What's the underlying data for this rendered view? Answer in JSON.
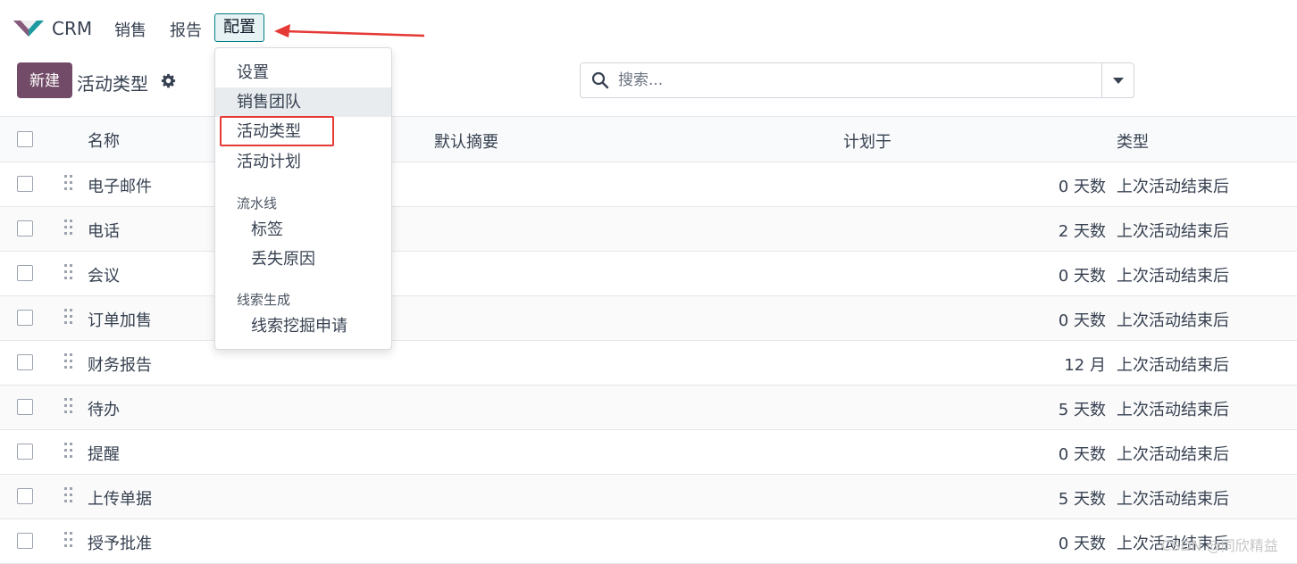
{
  "navbar": {
    "app_name": "CRM",
    "menus": [
      "销售",
      "报告",
      "配置"
    ],
    "active_menu": "配置"
  },
  "control_panel": {
    "new_button": "新建",
    "title": "活动类型",
    "search_placeholder": "搜索..."
  },
  "table": {
    "headers": {
      "name": "名称",
      "summary": "默认摘要",
      "plan": "计划于",
      "type": "类型"
    },
    "rows": [
      {
        "name": "电子邮件",
        "delay": "0 天数",
        "after": "上次活动结束后"
      },
      {
        "name": "电话",
        "delay": "2 天数",
        "after": "上次活动结束后"
      },
      {
        "name": "会议",
        "delay": "0 天数",
        "after": "上次活动结束后"
      },
      {
        "name": "订单加售",
        "delay": "0 天数",
        "after": "上次活动结束后"
      },
      {
        "name": "财务报告",
        "delay": "12 月",
        "after": "上次活动结束后"
      },
      {
        "name": "待办",
        "delay": "5 天数",
        "after": "上次活动结束后"
      },
      {
        "name": "提醒",
        "delay": "0 天数",
        "after": "上次活动结束后"
      },
      {
        "name": "上传单据",
        "delay": "5 天数",
        "after": "上次活动结束后"
      },
      {
        "name": "授予批准",
        "delay": "0 天数",
        "after": "上次活动结束后"
      }
    ]
  },
  "dropdown": {
    "items": [
      "设置",
      "销售团队",
      "活动类型",
      "活动计划"
    ],
    "section_pipeline": "流水线",
    "pipeline_items": [
      "标签",
      "丢失原因"
    ],
    "section_leads": "线索生成",
    "leads_items": [
      "线索挖掘申请"
    ],
    "hovered_item": "销售团队",
    "highlighted_item": "活动类型"
  },
  "watermark": "CSDN @同欣精益",
  "colors": {
    "primary": "#714b67",
    "accent": "#017e84",
    "annotation": "#e53935"
  }
}
